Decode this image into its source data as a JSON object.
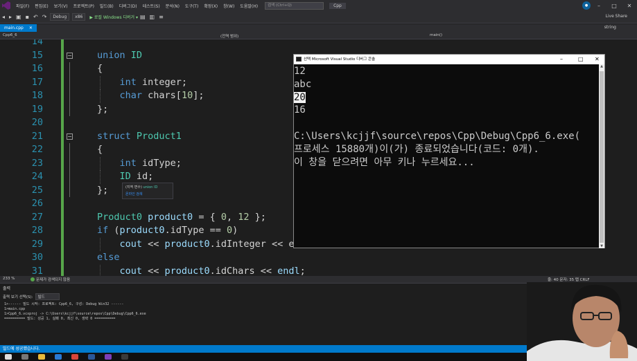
{
  "menu": {
    "items": [
      "파일(F)",
      "편집(E)",
      "보기(V)",
      "프로젝트(P)",
      "빌드(B)",
      "디버그(D)",
      "테스트(S)",
      "분석(N)",
      "도구(T)",
      "확장(X)",
      "창(W)",
      "도움말(H)"
    ],
    "search_placeholder": "검색 (Ctrl+Q)",
    "project_name": "Cpp"
  },
  "toolbar": {
    "config": "Debug",
    "platform": "x86",
    "run_label": "▶ 로컬 Windows 디버거 ▾",
    "live_share": "Live Share"
  },
  "tab": {
    "label": "main.cpp",
    "close": "✕",
    "right_dropdown": "string"
  },
  "navbar": {
    "project": "Cpp6_6",
    "scope": "(전역 범위)",
    "member": "main()"
  },
  "editor": {
    "lines": [
      {
        "n": "14",
        "tokens": []
      },
      {
        "n": "15",
        "tokens": [
          [
            "kw",
            "union "
          ],
          [
            "ty",
            "ID"
          ]
        ]
      },
      {
        "n": "16",
        "tokens": [
          [
            "pl",
            "{"
          ]
        ]
      },
      {
        "n": "17",
        "tokens": [
          [
            "pl",
            "    "
          ],
          [
            "kw",
            "int "
          ],
          [
            "pl",
            "integer;"
          ]
        ]
      },
      {
        "n": "18",
        "tokens": [
          [
            "pl",
            "    "
          ],
          [
            "kw",
            "char "
          ],
          [
            "pl",
            "chars["
          ],
          [
            "nm",
            "10"
          ],
          [
            "pl",
            "];"
          ]
        ]
      },
      {
        "n": "19",
        "tokens": [
          [
            "pl",
            "};"
          ]
        ]
      },
      {
        "n": "20",
        "tokens": []
      },
      {
        "n": "21",
        "tokens": [
          [
            "kw",
            "struct "
          ],
          [
            "ty",
            "Product1"
          ]
        ]
      },
      {
        "n": "22",
        "tokens": [
          [
            "pl",
            "{"
          ]
        ]
      },
      {
        "n": "23",
        "tokens": [
          [
            "pl",
            "    "
          ],
          [
            "kw",
            "int "
          ],
          [
            "pl",
            "idType;"
          ]
        ]
      },
      {
        "n": "24",
        "tokens": [
          [
            "pl",
            "    "
          ],
          [
            "ty",
            "ID "
          ],
          [
            "pl",
            "id;"
          ]
        ]
      },
      {
        "n": "25",
        "tokens": [
          [
            "pl",
            "};"
          ]
        ]
      },
      {
        "n": "26",
        "tokens": []
      },
      {
        "n": "27",
        "tokens": [
          [
            "ty",
            "Product0 "
          ],
          [
            "id",
            "product0"
          ],
          [
            "pl",
            " = { "
          ],
          [
            "nm",
            "0"
          ],
          [
            "pl",
            ", "
          ],
          [
            "nm",
            "12"
          ],
          [
            "pl",
            " };"
          ]
        ]
      },
      {
        "n": "28",
        "tokens": [
          [
            "kw",
            "if "
          ],
          [
            "pl",
            "("
          ],
          [
            "id",
            "product0"
          ],
          [
            "pl",
            ".idType == "
          ],
          [
            "nm",
            "0"
          ],
          [
            "pl",
            ")"
          ]
        ]
      },
      {
        "n": "29",
        "tokens": [
          [
            "pl",
            "    "
          ],
          [
            "id",
            "cout"
          ],
          [
            "pl",
            " << "
          ],
          [
            "id",
            "product0"
          ],
          [
            "pl",
            ".idInteger << e"
          ]
        ]
      },
      {
        "n": "30",
        "tokens": [
          [
            "kw",
            "else"
          ]
        ]
      },
      {
        "n": "31",
        "tokens": [
          [
            "pl",
            "    "
          ],
          [
            "id",
            "cout"
          ],
          [
            "pl",
            " << "
          ],
          [
            "id",
            "product0"
          ],
          [
            "pl",
            ".idChars << "
          ],
          [
            "id",
            "endl"
          ],
          [
            "pl",
            ";"
          ]
        ]
      }
    ],
    "tooltip_kind": "(지역 변수) ",
    "tooltip_name": "union ID",
    "tooltip_link": "온라인 검색"
  },
  "console": {
    "title": "선택 Microsoft Visual Studio 디버그 콘솔",
    "lines": [
      "12",
      "abc",
      "20",
      "16",
      "",
      "C:\\Users\\kcjjf\\source\\repos\\Cpp\\Debug\\Cpp6_6.exe(",
      "프로세스 15880개)이(가) 종료되었습니다(코드: 0개).",
      "이 창을 닫으려면 아무 키나 누르세요..."
    ],
    "selected_line_index": 2
  },
  "editor_status": {
    "zoom": "233 %",
    "issues": "문제가 검색되지 않음",
    "position": "줄: 40   문자: 35   탭   CRLF"
  },
  "output": {
    "header": "출력",
    "source_label": "출력 보기 선택(S):",
    "source_value": "빌드",
    "lines": [
      "1>------ 빌드 시작: 프로젝트: Cpp6_6, 구성: Debug Win32 ------",
      "1>main.cpp",
      "1>Cpp6_6.vcxproj -> C:\\Users\\kcjjf\\source\\repos\\Cpp\\Debug\\Cpp6_6.exe",
      "========== 빌드: 성공 1, 실패 0, 최신 0, 생략 0 =========="
    ]
  },
  "statusbar": {
    "text": "빌드에 성공했습니다."
  },
  "colors": {
    "accent": "#007acc",
    "keyword": "#569cd6",
    "type": "#4ec9b0",
    "identifier": "#9cdcfe",
    "number": "#b5cea8",
    "line_number": "#2b91af"
  },
  "icons": [
    "visual-studio-logo-icon",
    "undo-icon",
    "redo-icon",
    "run-icon",
    "minimize-icon",
    "maximize-icon",
    "close-icon",
    "webcam-person"
  ]
}
